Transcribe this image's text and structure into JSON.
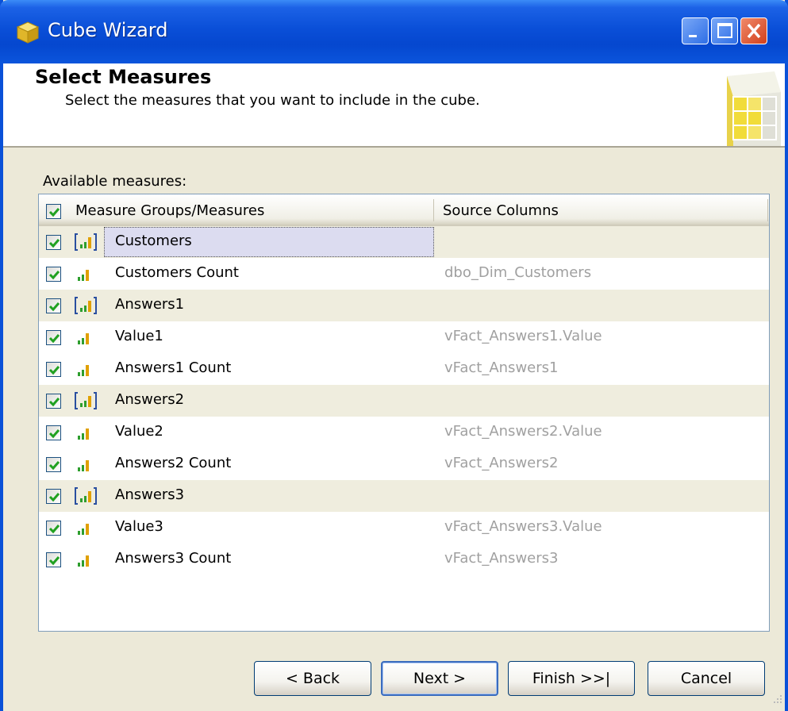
{
  "window": {
    "title": "Cube Wizard"
  },
  "header": {
    "title": "Select Measures",
    "subtitle": "Select the measures that you want to include in the cube."
  },
  "available_label": "Available measures:",
  "list": {
    "columns": [
      "Measure Groups/Measures",
      "Source Columns"
    ],
    "rows": [
      {
        "type": "group",
        "name": "Customers",
        "source": "",
        "checked": true,
        "selected": true
      },
      {
        "type": "measure",
        "name": "Customers Count",
        "source": "dbo_Dim_Customers",
        "checked": true
      },
      {
        "type": "group",
        "name": "Answers1",
        "source": "",
        "checked": true
      },
      {
        "type": "measure",
        "name": "Value1",
        "source": "vFact_Answers1.Value",
        "checked": true
      },
      {
        "type": "measure",
        "name": "Answers1 Count",
        "source": "vFact_Answers1",
        "checked": true
      },
      {
        "type": "group",
        "name": "Answers2",
        "source": "",
        "checked": true
      },
      {
        "type": "measure",
        "name": "Value2",
        "source": "vFact_Answers2.Value",
        "checked": true
      },
      {
        "type": "measure",
        "name": "Answers2 Count",
        "source": "vFact_Answers2",
        "checked": true
      },
      {
        "type": "group",
        "name": "Answers3",
        "source": "",
        "checked": true
      },
      {
        "type": "measure",
        "name": "Value3",
        "source": "vFact_Answers3.Value",
        "checked": true
      },
      {
        "type": "measure",
        "name": "Answers3 Count",
        "source": "vFact_Answers3",
        "checked": true
      }
    ]
  },
  "buttons": {
    "back": "< Back",
    "next": "Next >",
    "finish": "Finish >>|",
    "cancel": "Cancel"
  },
  "colors": {
    "titlebar": "#0a4fd8",
    "dialog_bg": "#ece9d8",
    "group_row_bg": "#efedde",
    "source_text": "#a0a0a0",
    "check": "#21a121"
  }
}
